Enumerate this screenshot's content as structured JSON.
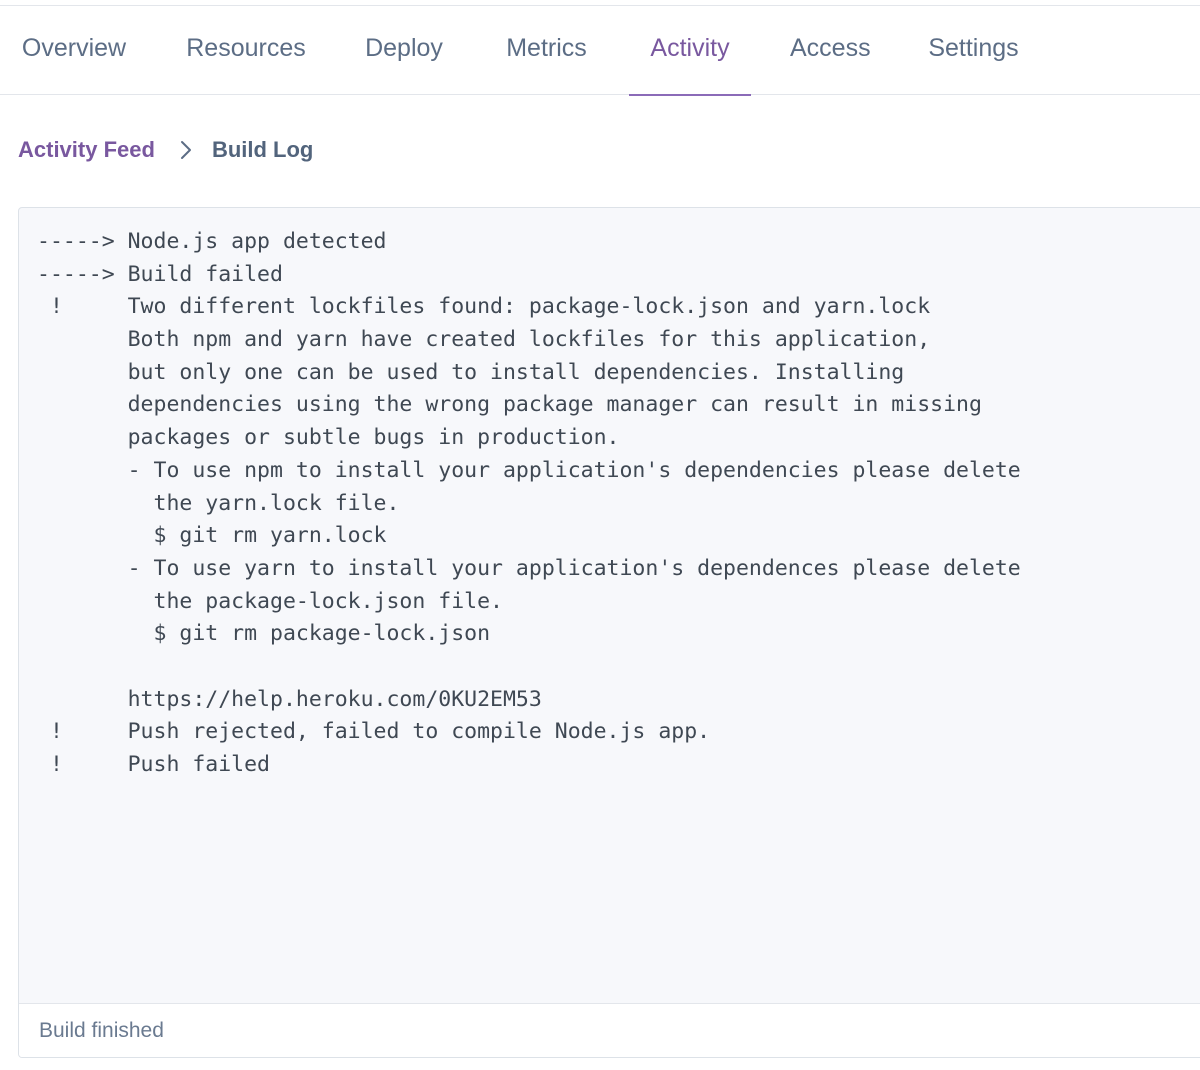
{
  "tabs": [
    {
      "label": "Overview"
    },
    {
      "label": "Resources"
    },
    {
      "label": "Deploy"
    },
    {
      "label": "Metrics"
    },
    {
      "label": "Activity",
      "active": true
    },
    {
      "label": "Access"
    },
    {
      "label": "Settings"
    }
  ],
  "breadcrumb": {
    "parent": "Activity Feed",
    "separator_icon": "chevron-right-icon",
    "current": "Build Log"
  },
  "build_log": {
    "lines": [
      "-----> Node.js app detected",
      "-----> Build failed",
      " !     Two different lockfiles found: package-lock.json and yarn.lock",
      "       Both npm and yarn have created lockfiles for this application,",
      "       but only one can be used to install dependencies. Installing",
      "       dependencies using the wrong package manager can result in missing",
      "       packages or subtle bugs in production.",
      "       - To use npm to install your application's dependencies please delete",
      "         the yarn.lock file.",
      "         $ git rm yarn.lock",
      "       - To use yarn to install your application's dependences please delete",
      "         the package-lock.json file.",
      "         $ git rm package-lock.json",
      "",
      "       https://help.heroku.com/0KU2EM53",
      " !     Push rejected, failed to compile Node.js app.",
      " !     Push failed"
    ],
    "status": "Build finished"
  },
  "colors": {
    "accent": "#79589f",
    "tab_text": "#5c6d85",
    "log_background": "#f7f8fb"
  }
}
